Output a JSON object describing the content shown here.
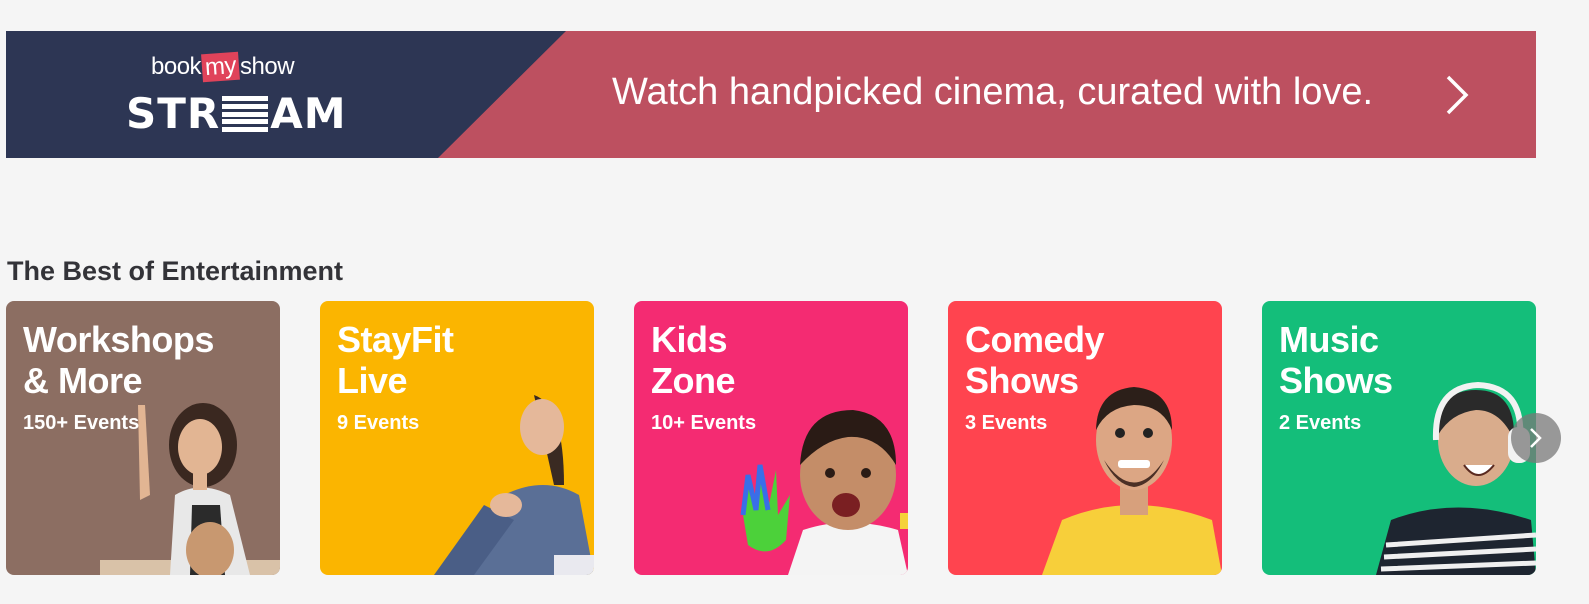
{
  "banner": {
    "brand_top_left": "book",
    "brand_top_mid": "my",
    "brand_top_right": "show",
    "brand_stream_left": "STR",
    "brand_stream_right": "AM",
    "tagline": "Watch handpicked cinema, curated with love.",
    "chevron_icon": "chevron-right-icon",
    "colors": {
      "navy": "#2d3654",
      "rose": "#bd5060"
    }
  },
  "section": {
    "title": "The Best of Entertainment",
    "cards": [
      {
        "line1": "Workshops",
        "line2": "& More",
        "count": "150+ Events",
        "color": "#8c6e62"
      },
      {
        "line1": "StayFit",
        "line2": "Live",
        "count": "9 Events",
        "color": "#fbb500"
      },
      {
        "line1": "Kids",
        "line2": "Zone",
        "count": "10+ Events",
        "color": "#f42b72"
      },
      {
        "line1": "Comedy",
        "line2": "Shows",
        "count": "3 Events",
        "color": "#ff444f"
      },
      {
        "line1": "Music",
        "line2": "Shows",
        "count": "2 Events",
        "color": "#14be7a"
      }
    ],
    "next_icon": "chevron-right-icon"
  }
}
